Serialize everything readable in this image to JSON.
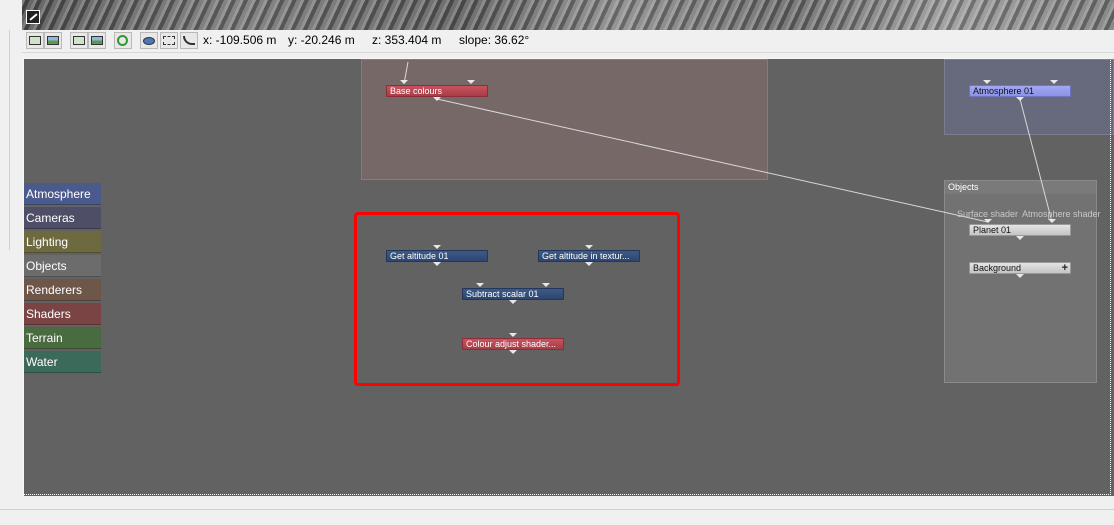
{
  "toolbar": {
    "coords": {
      "x": "x: -109.506 m",
      "y": "y: -20.246 m",
      "z": "z: 353.404 m",
      "slope": "slope: 36.62°"
    },
    "buttons": [
      "camera-view",
      "render-preview",
      "camera-image",
      "refresh",
      "eye",
      "frame",
      "curve"
    ]
  },
  "palette": {
    "categories": [
      {
        "label": "Atmosphere",
        "color": "#4a5a8c"
      },
      {
        "label": "Cameras",
        "color": "#4e4e66"
      },
      {
        "label": "Lighting",
        "color": "#6e6a40"
      },
      {
        "label": "Objects",
        "color": "#6c6c6c"
      },
      {
        "label": "Renderers",
        "color": "#6e5648"
      },
      {
        "label": "Shaders",
        "color": "#7a4444"
      },
      {
        "label": "Terrain",
        "color": "#4a6a40"
      },
      {
        "label": "Water",
        "color": "#3c6a5a"
      }
    ]
  },
  "groups": {
    "objects_title": "Objects"
  },
  "nodes": {
    "base_colours": "Base colours",
    "atmosphere": "Atmosphere 01",
    "planet": "Planet 01",
    "background": "Background",
    "get_altitude": "Get altitude 01",
    "get_altitude_texture": "Get altitude in textur...",
    "subtract_scalar": "Subtract scalar 01",
    "colour_adjust": "Colour adjust shader..."
  },
  "ports": {
    "surface_shader": "Surface shader",
    "atmosphere_shader": "Atmosphere shader"
  },
  "colors": {
    "editor_bg": "#626262",
    "highlight": "#ff0000",
    "shader_node": "#b84651",
    "function_node": "#35507c",
    "atmosphere_node": "#979df0"
  }
}
